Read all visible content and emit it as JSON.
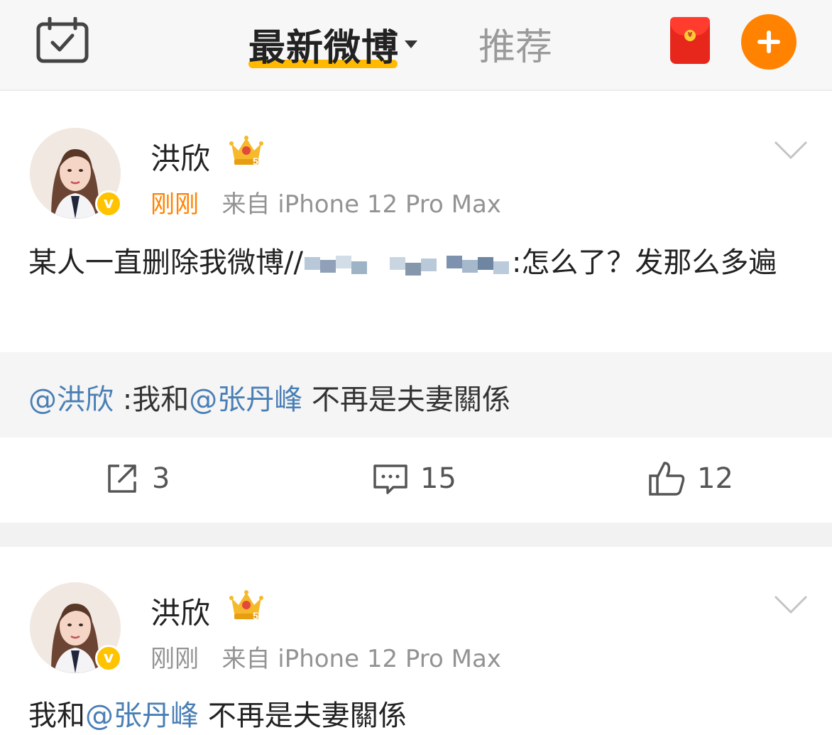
{
  "header": {
    "tab_latest": "最新微博",
    "tab_recommend": "推荐",
    "icons": {
      "calendar": "calendar-check-icon",
      "red_packet": "red-packet-icon",
      "add": "plus-icon"
    },
    "colors": {
      "accent_underline": "#ffb900",
      "add_button": "#ff8200",
      "red_packet": "#e8271c"
    }
  },
  "posts": [
    {
      "user": "洪欣",
      "time": "刚刚",
      "source": "来自 iPhone 12 Pro Max",
      "content_before": "某人一直删除我微博//",
      "content_after": ":怎么了？发那么多遍",
      "repost": {
        "mention_user": "@洪欣",
        "prefix": " :我和",
        "mention_target": "@张丹峰",
        "suffix": " 不再是夫妻關係"
      },
      "actions": {
        "share": "3",
        "comment": "15",
        "like": "12"
      }
    },
    {
      "user": "洪欣",
      "time": "刚刚",
      "source": "来自 iPhone 12 Pro Max",
      "content_prefix": "我和",
      "content_mention": "@张丹峰",
      "content_suffix": " 不再是夫妻關係"
    }
  ],
  "colors": {
    "mention": "#4a7fb5",
    "time_highlight": "#ff8200",
    "verified_badge": "#ffc300"
  }
}
